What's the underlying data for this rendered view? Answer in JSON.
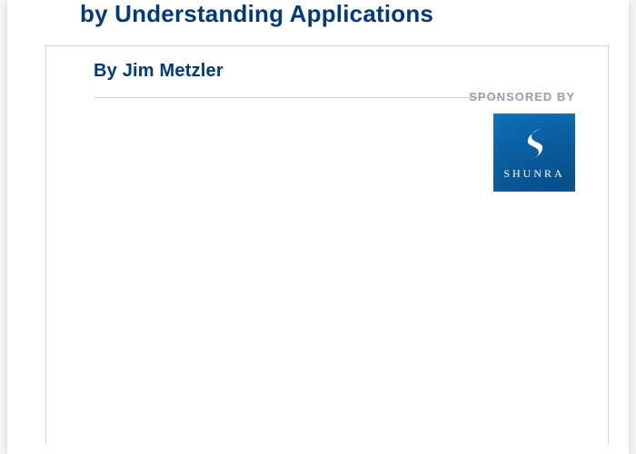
{
  "document": {
    "title_line": "by Understanding Applications",
    "byline": "By Jim Metzler",
    "sponsored_label": "SPONSORED BY",
    "sponsor": {
      "name": "SHUNRA"
    }
  }
}
